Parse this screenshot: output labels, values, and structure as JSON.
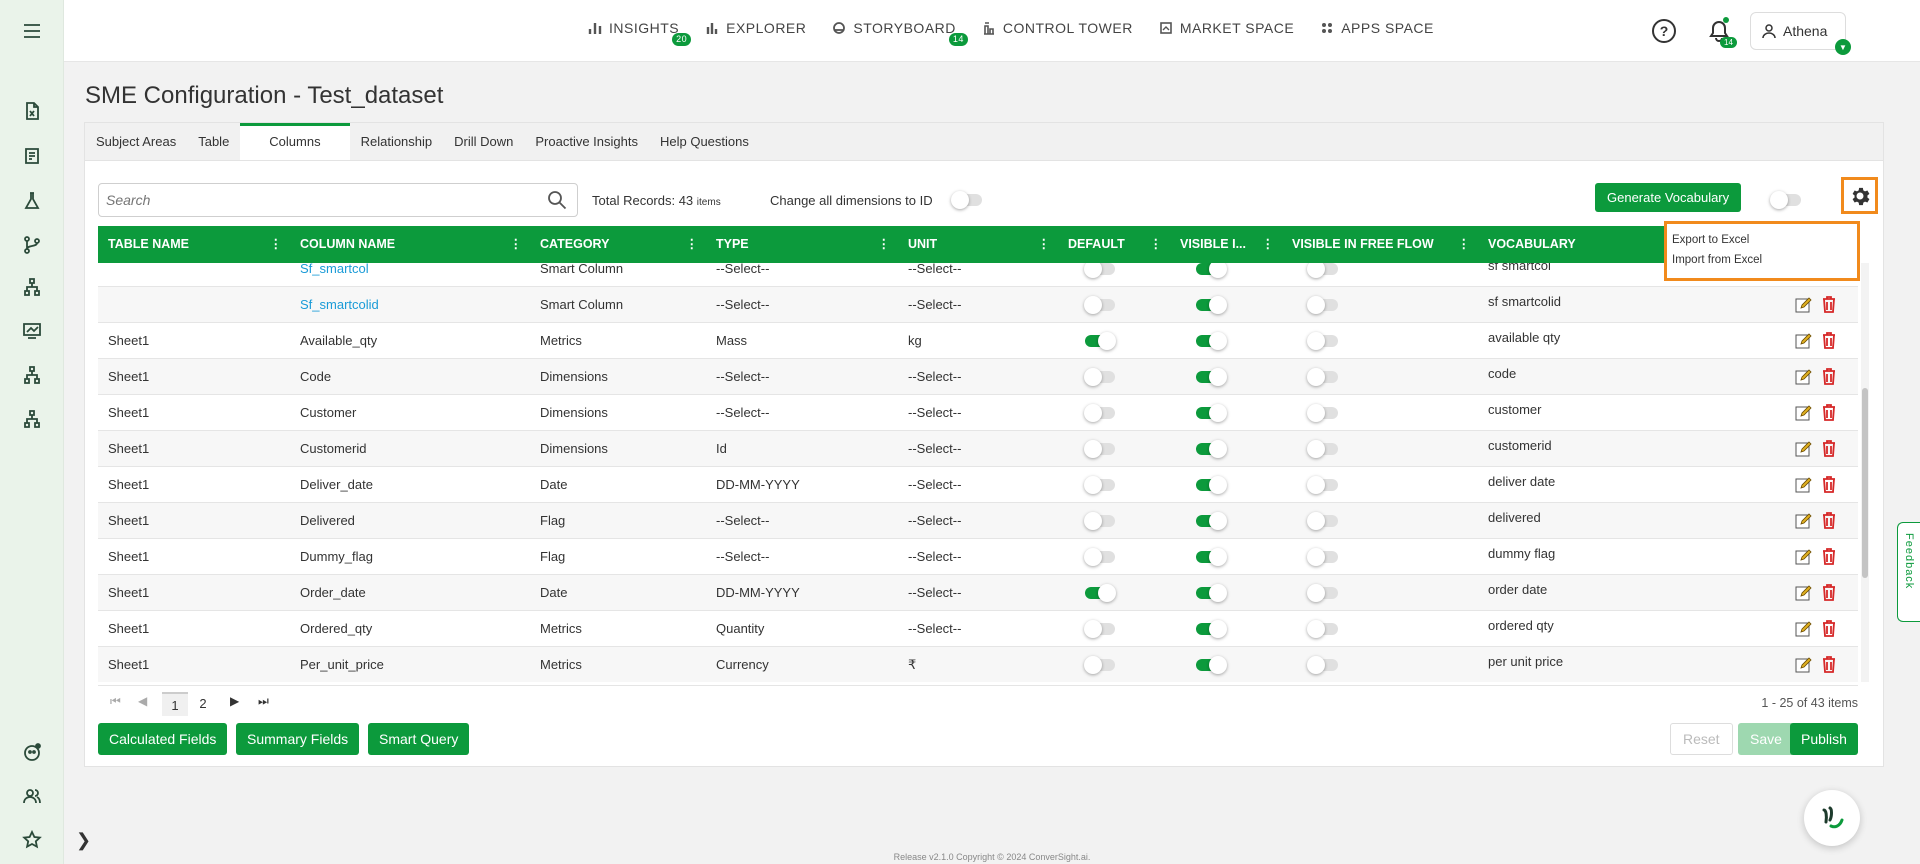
{
  "nav": [
    {
      "label": "INSIGHTS",
      "badge": "20",
      "icon": "bar-chart-icon"
    },
    {
      "label": "EXPLORER",
      "badge": "",
      "icon": "explorer-icon"
    },
    {
      "label": "STORYBOARD",
      "badge": "14",
      "icon": "storyboard-icon"
    },
    {
      "label": "CONTROL TOWER",
      "badge": "",
      "icon": "control-tower-icon"
    },
    {
      "label": "MARKET SPACE",
      "badge": "",
      "icon": "market-space-icon"
    },
    {
      "label": "APPS SPACE",
      "badge": "",
      "icon": "apps-space-icon"
    }
  ],
  "header": {
    "notifications_badge": "14",
    "user_name": "Athena",
    "help_symbol": "?"
  },
  "page": {
    "title": "SME Configuration - Test_dataset"
  },
  "tabs": [
    "Subject Areas",
    "Table",
    "Columns",
    "Relationship",
    "Drill Down",
    "Proactive Insights",
    "Help Questions"
  ],
  "active_tab": "Columns",
  "toolbar": {
    "search_placeholder": "Search",
    "total_label": "Total Records: 43",
    "total_unit": "items",
    "change_dimensions_label": "Change all dimensions to ID",
    "generate_vocabulary": "Generate Vocabulary"
  },
  "settings_menu": [
    "Export to Excel",
    "Import from Excel"
  ],
  "columns": [
    "TABLE NAME",
    "COLUMN NAME",
    "CATEGORY",
    "TYPE",
    "UNIT",
    "DEFAULT",
    "VISIBLE I...",
    "VISIBLE IN FREE FLOW",
    "VOCABULARY"
  ],
  "rows": [
    {
      "table": "",
      "column": "Sf_smartcol",
      "link": true,
      "category": "Smart Column",
      "type": "--Select--",
      "unit": "--Select--",
      "default": false,
      "visible": true,
      "free_flow": false,
      "vocabulary": "sf smartcol"
    },
    {
      "table": "",
      "column": "Sf_smartcolid",
      "link": true,
      "category": "Smart Column",
      "type": "--Select--",
      "unit": "--Select--",
      "default": false,
      "visible": true,
      "free_flow": false,
      "vocabulary": "sf smartcolid"
    },
    {
      "table": "Sheet1",
      "column": "Available_qty",
      "link": false,
      "category": "Metrics",
      "type": "Mass",
      "unit": "kg",
      "default": true,
      "visible": true,
      "free_flow": false,
      "vocabulary": "available qty"
    },
    {
      "table": "Sheet1",
      "column": "Code",
      "link": false,
      "category": "Dimensions",
      "type": "--Select--",
      "unit": "--Select--",
      "default": false,
      "visible": true,
      "free_flow": false,
      "vocabulary": "code"
    },
    {
      "table": "Sheet1",
      "column": "Customer",
      "link": false,
      "category": "Dimensions",
      "type": "--Select--",
      "unit": "--Select--",
      "default": false,
      "visible": true,
      "free_flow": false,
      "vocabulary": "customer"
    },
    {
      "table": "Sheet1",
      "column": "Customerid",
      "link": false,
      "category": "Dimensions",
      "type": "Id",
      "unit": "--Select--",
      "default": false,
      "visible": true,
      "free_flow": false,
      "vocabulary": "customerid"
    },
    {
      "table": "Sheet1",
      "column": "Deliver_date",
      "link": false,
      "category": "Date",
      "type": "DD-MM-YYYY",
      "unit": "--Select--",
      "default": false,
      "visible": true,
      "free_flow": false,
      "vocabulary": "deliver date"
    },
    {
      "table": "Sheet1",
      "column": "Delivered",
      "link": false,
      "category": "Flag",
      "type": "--Select--",
      "unit": "--Select--",
      "default": false,
      "visible": true,
      "free_flow": false,
      "vocabulary": "delivered"
    },
    {
      "table": "Sheet1",
      "column": "Dummy_flag",
      "link": false,
      "category": "Flag",
      "type": "--Select--",
      "unit": "--Select--",
      "default": false,
      "visible": true,
      "free_flow": false,
      "vocabulary": "dummy flag"
    },
    {
      "table": "Sheet1",
      "column": "Order_date",
      "link": false,
      "category": "Date",
      "type": "DD-MM-YYYY",
      "unit": "--Select--",
      "default": true,
      "visible": true,
      "free_flow": false,
      "vocabulary": "order date"
    },
    {
      "table": "Sheet1",
      "column": "Ordered_qty",
      "link": false,
      "category": "Metrics",
      "type": "Quantity",
      "unit": "--Select--",
      "default": false,
      "visible": true,
      "free_flow": false,
      "vocabulary": "ordered qty"
    },
    {
      "table": "Sheet1",
      "column": "Per_unit_price",
      "link": false,
      "category": "Metrics",
      "type": "Currency",
      "unit": "₹",
      "default": false,
      "visible": true,
      "free_flow": false,
      "vocabulary": "per unit price"
    }
  ],
  "pager": {
    "pages": [
      "1",
      "2"
    ],
    "current": "1",
    "info": "1 - 25 of 43 items"
  },
  "buttons": {
    "calculated_fields": "Calculated Fields",
    "summary_fields": "Summary Fields",
    "smart_query": "Smart Query",
    "reset": "Reset",
    "save": "Save",
    "publish": "Publish"
  },
  "footer": "Release v2.1.0 Copyright © 2024 ConverSight.ai.",
  "feedback_label": "Feedback",
  "colors": {
    "primary": "#0c9a3c",
    "highlight": "#f18a1c",
    "link": "#1a9bd7",
    "delete": "#d62828"
  }
}
